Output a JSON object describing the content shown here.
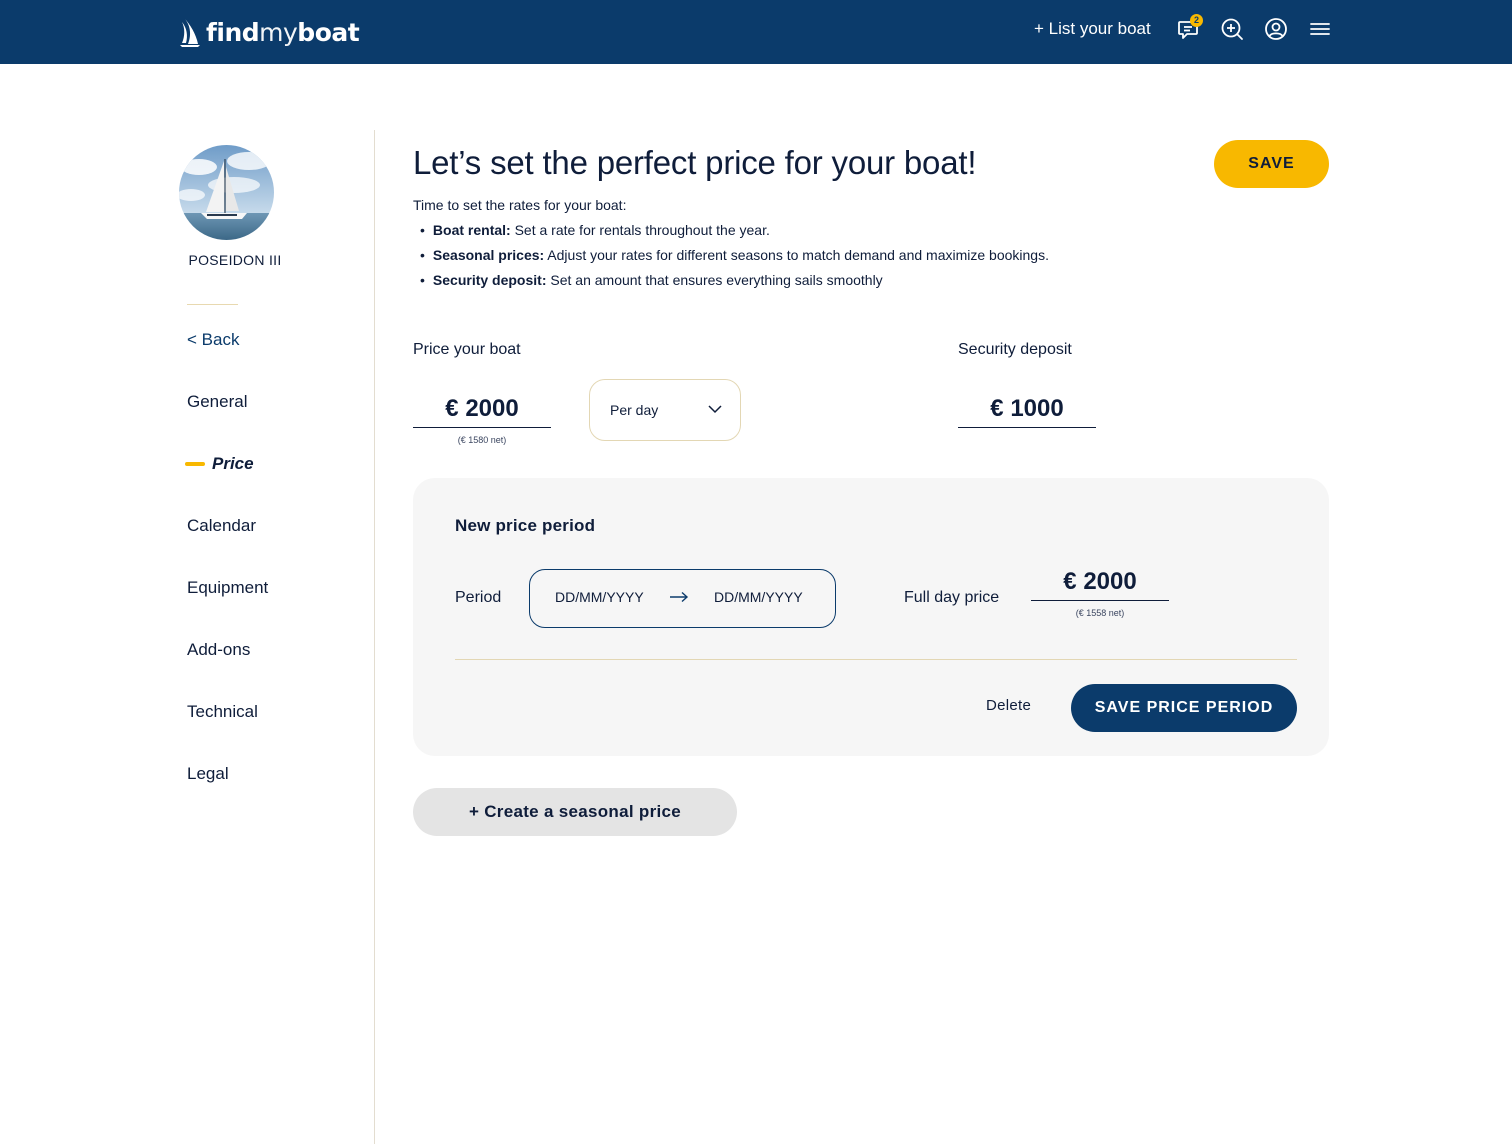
{
  "header": {
    "logo": {
      "part1": "find",
      "part2": "my",
      "part3": "boat"
    },
    "list_boat_label": "+ List your boat",
    "messages_badge": "2",
    "icons": [
      "messages-icon",
      "search-add-icon",
      "user-account-icon",
      "menu-icon"
    ]
  },
  "sidebar": {
    "boat_name": "POSEIDON III",
    "back_label": "< Back",
    "items": [
      {
        "label": "General",
        "active": false
      },
      {
        "label": "Price",
        "active": true
      },
      {
        "label": "Calendar",
        "active": false
      },
      {
        "label": "Equipment",
        "active": false
      },
      {
        "label": "Add-ons",
        "active": false
      },
      {
        "label": "Technical",
        "active": false
      },
      {
        "label": "Legal",
        "active": false
      }
    ]
  },
  "main": {
    "title": "Let’s set the perfect price for your boat!",
    "save_label": "SAVE",
    "intro": "Time to set the rates for your boat:",
    "bullets": [
      {
        "term": "Boat rental:",
        "text": " Set a rate for rentals throughout the year."
      },
      {
        "term": "Seasonal prices:",
        "text": " Adjust your rates for different seasons to match demand and maximize bookings."
      },
      {
        "term": "Security deposit:",
        "text": " Set an amount that ensures everything sails smoothly"
      }
    ],
    "price": {
      "label": "Price your boat",
      "value": "€ 2000",
      "net": "(€ 1580 net)",
      "unit_selected": "Per day"
    },
    "deposit": {
      "label": "Security deposit",
      "value": "€ 1000"
    },
    "price_period": {
      "title": "New price period",
      "period_label": "Period",
      "start_placeholder": "DD/MM/YYYY",
      "end_placeholder": "DD/MM/YYYY",
      "full_day_label": "Full day price",
      "full_day_value": "€ 2000",
      "full_day_net": "(€ 1558 net)",
      "delete_label": "Delete",
      "save_label": "SAVE PRICE PERIOD"
    },
    "create_seasonal_label": "+ Create a seasonal price"
  },
  "colors": {
    "primary": "#0b3b6b",
    "accent": "#f8b800",
    "card_bg": "#f6f6f6",
    "text": "#0f1d3a"
  }
}
